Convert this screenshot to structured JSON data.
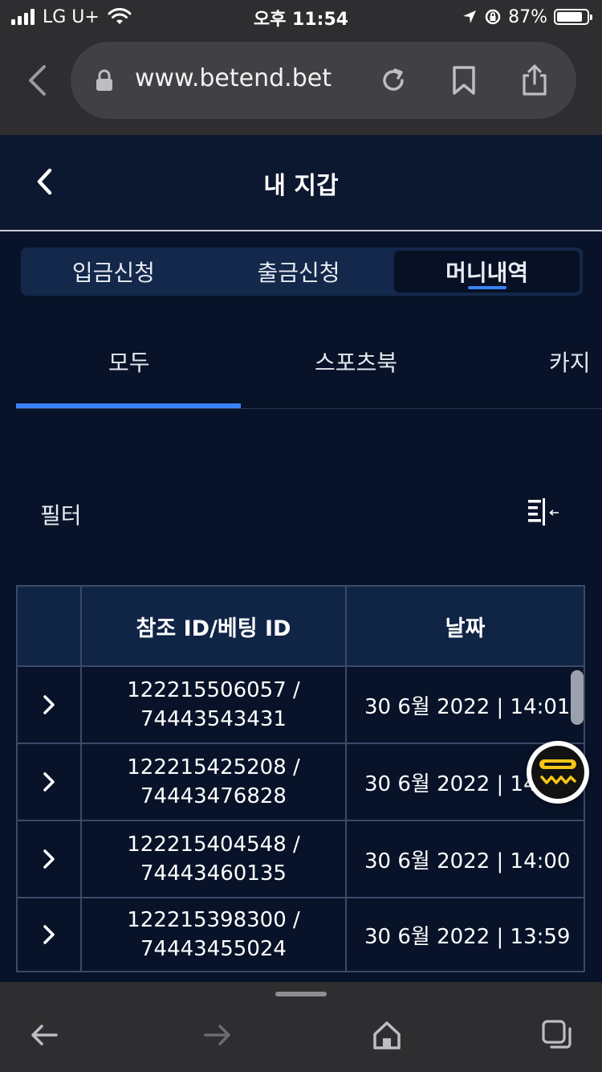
{
  "status_bar": {
    "carrier": "LG U+",
    "time": "오후 11:54",
    "battery": "87%",
    "battery_level": 0.87
  },
  "browser": {
    "url": "www.betend.bet"
  },
  "header": {
    "title": "내 지갑"
  },
  "segments": [
    {
      "label": "입금신청",
      "active": false
    },
    {
      "label": "출금신청",
      "active": false
    },
    {
      "label": "머니내역",
      "active": true
    }
  ],
  "subtabs": [
    {
      "label": "모두",
      "active": true
    },
    {
      "label": "스포츠북",
      "active": false
    },
    {
      "label": "카지",
      "active": false
    }
  ],
  "filter": {
    "label": "필터"
  },
  "table": {
    "columns": [
      "",
      "참조 ID/베팅 ID",
      "날짜"
    ],
    "rows": [
      {
        "ref_id": "122215506057 /",
        "bet_id": "74443543431",
        "date": "30 6월 2022 | 14:01"
      },
      {
        "ref_id": "122215425208 /",
        "bet_id": "74443476828",
        "date": "30 6월 2022 | 14:00"
      },
      {
        "ref_id": "122215404548 /",
        "bet_id": "74443460135",
        "date": "30 6월 2022 | 14:00"
      },
      {
        "ref_id": "122215398300 /",
        "bet_id": "74443455024",
        "date": "30 6월 2022 | 13:59"
      }
    ]
  },
  "colors": {
    "background": "#081329",
    "accent": "#3b82f6",
    "header_bg": "#0c1730",
    "table_header_bg": "#102446",
    "chat_stripe": "#f5c518"
  }
}
